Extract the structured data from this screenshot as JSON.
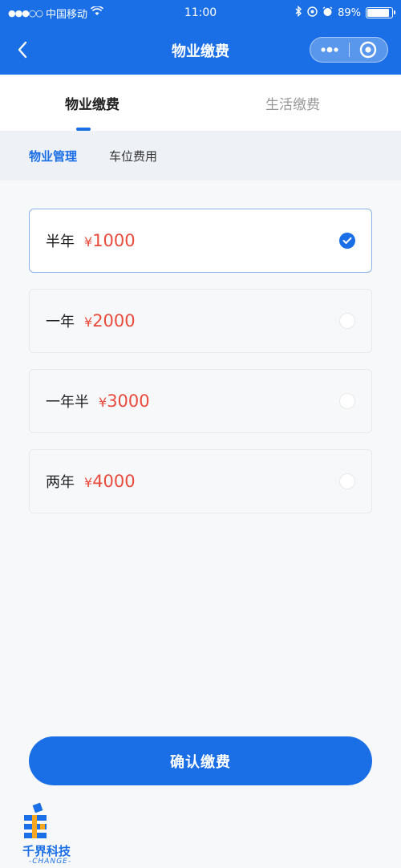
{
  "status_bar": {
    "carrier": "中国移动",
    "time": "11:00",
    "battery": "89%",
    "battery_level": 0.89
  },
  "nav": {
    "title": "物业缴费"
  },
  "tabs": [
    {
      "label": "物业缴费",
      "active": true
    },
    {
      "label": "生活缴费",
      "active": false
    }
  ],
  "subtabs": [
    {
      "label": "物业管理",
      "active": true
    },
    {
      "label": "车位费用",
      "active": false
    }
  ],
  "options": [
    {
      "label": "半年",
      "currency": "¥",
      "price": "1000",
      "selected": true
    },
    {
      "label": "一年",
      "currency": "¥",
      "price": "2000",
      "selected": false
    },
    {
      "label": "一年半",
      "currency": "¥",
      "price": "3000",
      "selected": false
    },
    {
      "label": "两年",
      "currency": "¥",
      "price": "4000",
      "selected": false
    }
  ],
  "confirm": {
    "label": "确认缴费"
  },
  "logo": {
    "text": "千界科技",
    "sub": "-CHANGE-"
  },
  "colors": {
    "brand": "#1a6fe6",
    "price": "#e94b3c"
  }
}
